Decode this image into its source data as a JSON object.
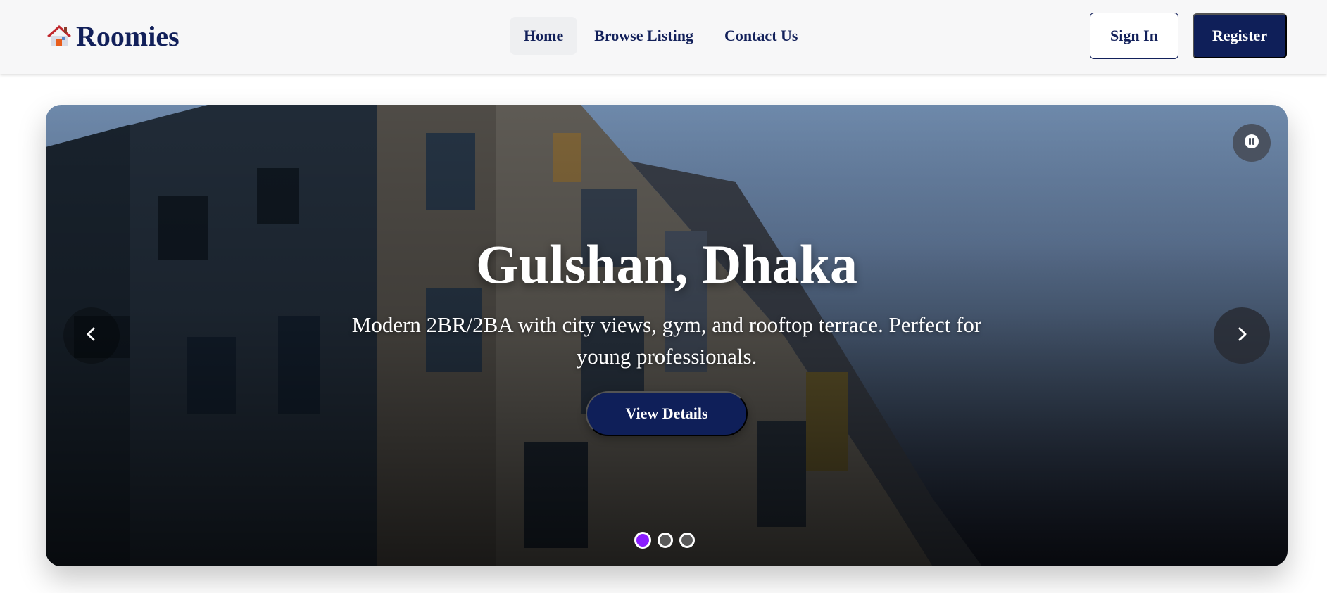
{
  "brand": {
    "name": "Roomies",
    "logo_icon": "house-icon"
  },
  "nav": {
    "links": [
      {
        "label": "Home",
        "active": true
      },
      {
        "label": "Browse Listing",
        "active": false
      },
      {
        "label": "Contact Us",
        "active": false
      }
    ]
  },
  "auth": {
    "signin_label": "Sign In",
    "register_label": "Register"
  },
  "hero": {
    "slide": {
      "title": "Gulshan, Dhaka",
      "description": "Modern 2BR/2BA with city views, gym, and rooftop terrace. Perfect for young professionals.",
      "cta_label": "View Details"
    },
    "controls": {
      "prev_icon": "chevron-left-icon",
      "next_icon": "chevron-right-icon",
      "pause_icon": "pause-icon"
    },
    "slides_count": 3,
    "active_slide": 1
  },
  "colors": {
    "primary": "#0f1f59",
    "active_dot": "#8a1cff",
    "navbar_bg": "#f7f7f8"
  }
}
